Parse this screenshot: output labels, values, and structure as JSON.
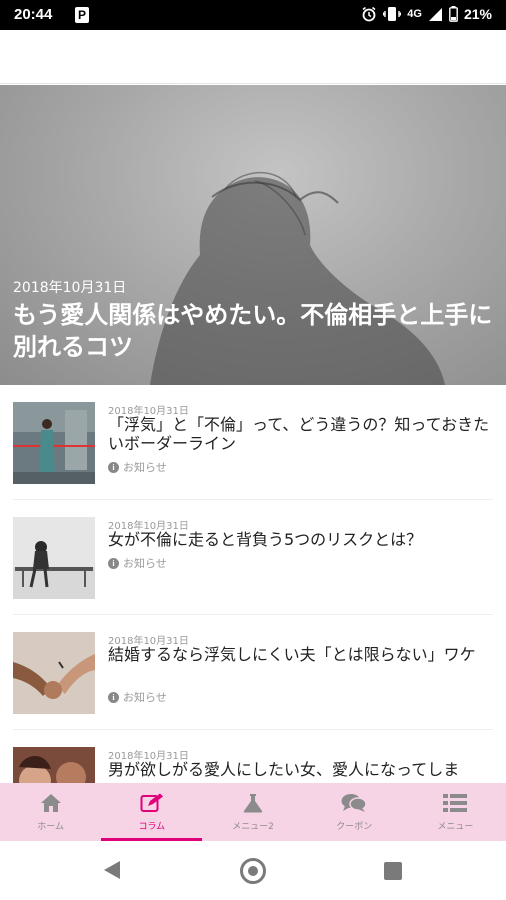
{
  "status_bar": {
    "time": "20:44",
    "app_badge": "P",
    "network": "4G",
    "battery": "21%"
  },
  "hero": {
    "date": "2018年10月31日",
    "title": "もう愛人関係はやめたい。不倫相手と上手に別れるコツ"
  },
  "articles": [
    {
      "date": "2018年10月31日",
      "title": "「浮気」と「不倫」って、どう違うの？知っておきたいボーダーライン",
      "tag": "お知らせ"
    },
    {
      "date": "2018年10月31日",
      "title": "女が不倫に走ると背負う5つのリスクとは？",
      "tag": "お知らせ"
    },
    {
      "date": "2018年10月31日",
      "title": "結婚するなら浮気しにくい夫「とは限らない」ワケ",
      "tag": "お知らせ"
    },
    {
      "date": "2018年10月31日",
      "title": "男が欲しがる愛人にしたい女、愛人になってしま",
      "tag": ""
    }
  ],
  "tabs": [
    {
      "label": "ホーム",
      "icon": "home-icon",
      "active": false
    },
    {
      "label": "コラム",
      "icon": "edit-icon",
      "active": true
    },
    {
      "label": "メニュー2",
      "icon": "flask-icon",
      "active": false
    },
    {
      "label": "クーポン",
      "icon": "chat-icon",
      "active": false
    },
    {
      "label": "メニュー",
      "icon": "list-icon",
      "active": false
    }
  ],
  "colors": {
    "accent": "#e0007a",
    "tab_bar_bg": "#f7d3e6",
    "tab_icon": "#8b8b8b"
  }
}
